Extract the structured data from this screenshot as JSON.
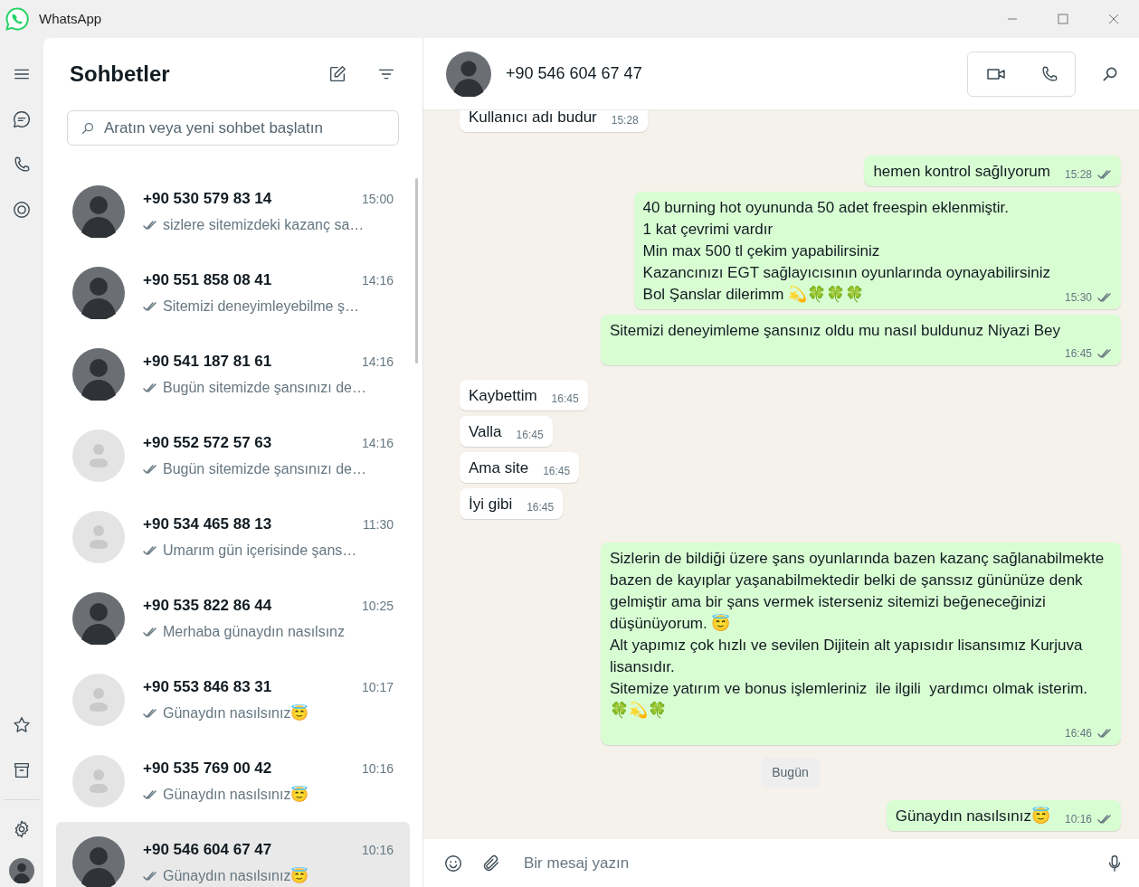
{
  "window": {
    "title": "WhatsApp"
  },
  "chat_list": {
    "title": "Sohbetler",
    "search": {
      "placeholder": "Aratın veya yeni sohbet başlatın"
    },
    "chats": [
      {
        "name": "+90 530 579 83 14",
        "time": "15:00",
        "preview": "sizlere sitemizdeki kazanç sa…",
        "has_photo": true,
        "selected": false
      },
      {
        "name": "+90 551 858 08 41",
        "time": "14:16",
        "preview": "Sitemizi deneyimleyebilme ş…",
        "has_photo": true,
        "selected": false
      },
      {
        "name": "+90 541 187 81 61",
        "time": "14:16",
        "preview": "Bugün sitemizde şansınızı de…",
        "has_photo": true,
        "selected": false
      },
      {
        "name": "+90 552 572 57 63",
        "time": "14:16",
        "preview": "Bugün sitemizde şansınızı de…",
        "has_photo": false,
        "selected": false
      },
      {
        "name": "+90 534 465 88 13",
        "time": "11:30",
        "preview": "Umarım gün içerisinde şans…",
        "has_photo": false,
        "selected": false
      },
      {
        "name": "+90 535 822 86 44",
        "time": "10:25",
        "preview": "Merhaba günaydın nasılsınz",
        "has_photo": true,
        "selected": false
      },
      {
        "name": "+90 553 846 83 31",
        "time": "10:17",
        "preview": "Günaydın nasılsınız😇",
        "has_photo": false,
        "selected": false
      },
      {
        "name": "+90 535 769 00 42",
        "time": "10:16",
        "preview": "Günaydın nasılsınız😇",
        "has_photo": false,
        "selected": false
      },
      {
        "name": "+90 546 604 67 47",
        "time": "10:16",
        "preview": "Günaydın nasılsınız😇",
        "has_photo": true,
        "selected": true
      }
    ]
  },
  "conversation": {
    "name": "+90 546 604 67 47",
    "composer": {
      "placeholder": "Bir mesaj yazın"
    },
    "messages": [
      {
        "kind": "in",
        "text": "Kullanıcı adı budur",
        "time": "15:28"
      },
      {
        "kind": "out",
        "text": "hemen kontrol sağlıyorum",
        "time": "15:28"
      },
      {
        "kind": "out",
        "text": "40 burning hot oyununda 50 adet freespin eklenmiştir.\n1 kat çevrimi vardır\nMin max 500 tl çekim yapabilirsiniz\nKazancınızı EGT sağlayıcısının oyunlarında oynayabilirsiniz\nBol Şanslar dilerimm 💫🍀🍀🍀",
        "time": "15:30"
      },
      {
        "kind": "out",
        "text": "Sitemizi deneyimleme şansınız oldu mu nasıl buldunuz Niyazi Bey",
        "time": "16:45"
      },
      {
        "kind": "in",
        "text": "Kaybettim",
        "time": "16:45"
      },
      {
        "kind": "in",
        "text": "Valla",
        "time": "16:45"
      },
      {
        "kind": "in",
        "text": "Ama site",
        "time": "16:45"
      },
      {
        "kind": "in",
        "text": "İyi gibi",
        "time": "16:45"
      },
      {
        "kind": "out",
        "text": "Sizlerin de bildiği üzere şans oyunlarında bazen kazanç sağlanabilmekte  bazen de kayıplar yaşanabilmektedir belki de şanssız gününüze denk gelmiştir ama bir şans vermek isterseniz sitemizi beğeneceğinizi düşünüyorum. 😇\nAlt yapımız çok hızlı ve sevilen Dijitein alt yapısıdır lisansımız Kurjuva lisansıdır.\nSitemize yatırım ve bonus işlemleriniz  ile ilgili  yardımcı olmak isterim.  🍀💫🍀",
        "time": "16:46"
      },
      {
        "kind": "date",
        "text": "Bugün"
      },
      {
        "kind": "out",
        "text": "Günaydın nasılsınız😇",
        "time": "10:16"
      }
    ]
  }
}
